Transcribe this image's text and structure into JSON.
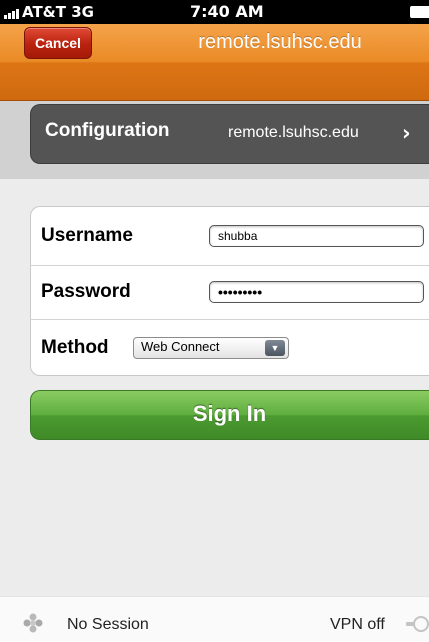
{
  "status_bar": {
    "carrier": "AT&T  3G",
    "time": "7:40 AM"
  },
  "nav_bar": {
    "cancel_label": "Cancel",
    "title": "remote.lsuhsc.edu"
  },
  "configuration": {
    "label": "Configuration",
    "value": "remote.lsuhsc.edu"
  },
  "form": {
    "username_label": "Username",
    "username_value": "shubba",
    "password_label": "Password",
    "password_value": "•••••••••",
    "method_label": "Method",
    "method_selected": "Web Connect"
  },
  "sign_in_label": "Sign In",
  "bottom_bar": {
    "session_status": "No Session",
    "vpn_status": "VPN off"
  },
  "colors": {
    "nav_orange": "#e07a18",
    "cancel_red": "#b8220e",
    "signin_green": "#5fae3f",
    "config_gray": "#545454"
  },
  "icons": [
    "signal-icon",
    "battery-icon",
    "chevron-right-icon",
    "dropdown-arrow-icon",
    "session-icon",
    "vpn-plug-icon"
  ]
}
